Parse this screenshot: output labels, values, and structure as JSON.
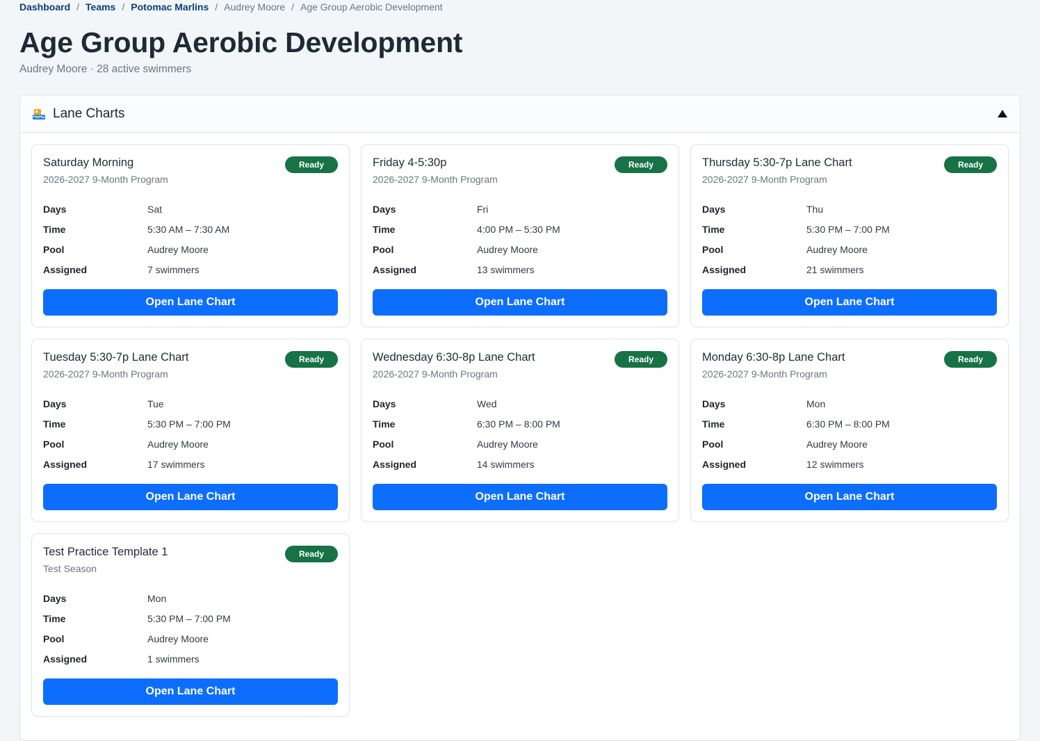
{
  "breadcrumb": [
    {
      "label": "Dashboard",
      "link": true
    },
    {
      "label": "Teams",
      "link": true
    },
    {
      "label": "Potomac Marlins",
      "link": true
    },
    {
      "label": "Audrey Moore",
      "link": false
    },
    {
      "label": "Age Group Aerobic Development",
      "link": false
    }
  ],
  "page": {
    "title": "Age Group Aerobic Development",
    "subtitle": "Audrey Moore · 28 active swimmers"
  },
  "panel": {
    "title": "Lane Charts",
    "icon": "pool-icon"
  },
  "labels": {
    "days": "Days",
    "time": "Time",
    "pool": "Pool",
    "assigned": "Assigned",
    "button": "Open Lane Chart"
  },
  "colors": {
    "badge": "#177245",
    "button": "#0d6efd"
  },
  "cards": [
    {
      "title": "Saturday Morning",
      "season": "2026-2027 9-Month Program",
      "status": "Ready",
      "days": "Sat",
      "time": "5:30 AM – 7:30 AM",
      "pool": "Audrey Moore",
      "assigned": "7 swimmers"
    },
    {
      "title": "Friday 4-5:30p",
      "season": "2026-2027 9-Month Program",
      "status": "Ready",
      "days": "Fri",
      "time": "4:00 PM – 5:30 PM",
      "pool": "Audrey Moore",
      "assigned": "13 swimmers"
    },
    {
      "title": "Thursday 5:30-7p Lane Chart",
      "season": "2026-2027 9-Month Program",
      "status": "Ready",
      "days": "Thu",
      "time": "5:30 PM – 7:00 PM",
      "pool": "Audrey Moore",
      "assigned": "21 swimmers"
    },
    {
      "title": "Tuesday 5:30-7p Lane Chart",
      "season": "2026-2027 9-Month Program",
      "status": "Ready",
      "days": "Tue",
      "time": "5:30 PM – 7:00 PM",
      "pool": "Audrey Moore",
      "assigned": "17 swimmers"
    },
    {
      "title": "Wednesday 6:30-8p Lane Chart",
      "season": "2026-2027 9-Month Program",
      "status": "Ready",
      "days": "Wed",
      "time": "6:30 PM – 8:00 PM",
      "pool": "Audrey Moore",
      "assigned": "14 swimmers"
    },
    {
      "title": "Monday 6:30-8p Lane Chart",
      "season": "2026-2027 9-Month Program",
      "status": "Ready",
      "days": "Mon",
      "time": "6:30 PM – 8:00 PM",
      "pool": "Audrey Moore",
      "assigned": "12 swimmers"
    },
    {
      "title": "Test Practice Template 1",
      "season": "Test Season",
      "status": "Ready",
      "days": "Mon",
      "time": "5:30 PM – 7:00 PM",
      "pool": "Audrey Moore",
      "assigned": "1 swimmers"
    }
  ]
}
